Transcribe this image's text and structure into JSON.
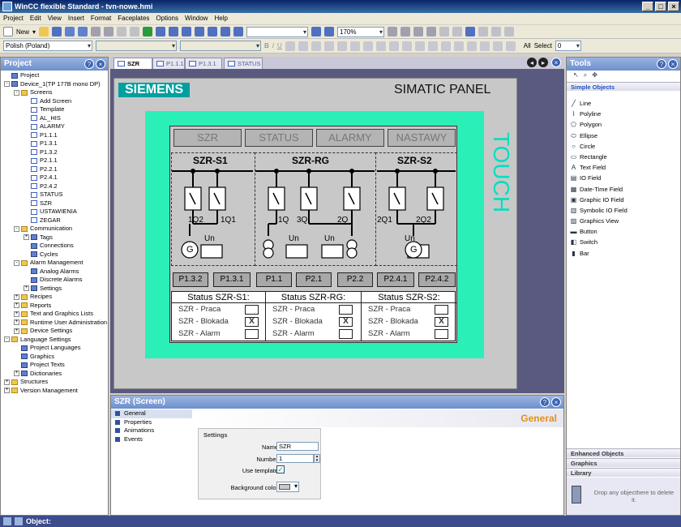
{
  "window": {
    "title": "WinCC flexible Standard - tvn-nowe.hmi"
  },
  "menu": [
    "Project",
    "Edit",
    "View",
    "Insert",
    "Format",
    "Faceplates",
    "Options",
    "Window",
    "Help"
  ],
  "toolbar": {
    "new_label": "New",
    "language": "Polish (Poland)",
    "zoom": "170%",
    "all_label": "All",
    "select_label": "Select",
    "select_value": "0"
  },
  "project_panel": {
    "title": "Project",
    "tree": [
      {
        "label": "Project",
        "level": 0,
        "icon": "gen"
      },
      {
        "label": "Device_1(TP 177B mono DP)",
        "level": 0,
        "icon": "gen",
        "toggle": "-"
      },
      {
        "label": "Screens",
        "level": 1,
        "icon": "fold",
        "toggle": "-"
      },
      {
        "label": "Add Screen",
        "level": 2,
        "icon": "scr"
      },
      {
        "label": "Template",
        "level": 2,
        "icon": "scr"
      },
      {
        "label": "AL_HIS",
        "level": 2,
        "icon": "scr"
      },
      {
        "label": "ALARMY",
        "level": 2,
        "icon": "scr"
      },
      {
        "label": "P1.1.1",
        "level": 2,
        "icon": "scr"
      },
      {
        "label": "P1.3.1",
        "level": 2,
        "icon": "scr"
      },
      {
        "label": "P1.3.2",
        "level": 2,
        "icon": "scr"
      },
      {
        "label": "P2.1.1",
        "level": 2,
        "icon": "scr"
      },
      {
        "label": "P2.2.1",
        "level": 2,
        "icon": "scr"
      },
      {
        "label": "P2.4.1",
        "level": 2,
        "icon": "scr"
      },
      {
        "label": "P2.4.2",
        "level": 2,
        "icon": "scr"
      },
      {
        "label": "STATUS",
        "level": 2,
        "icon": "scr"
      },
      {
        "label": "SZR",
        "level": 2,
        "icon": "scr"
      },
      {
        "label": "USTAWIENIA",
        "level": 2,
        "icon": "scr"
      },
      {
        "label": "ZEGAR",
        "level": 2,
        "icon": "scr"
      },
      {
        "label": "Communication",
        "level": 1,
        "icon": "fold",
        "toggle": "-"
      },
      {
        "label": "Tags",
        "level": 2,
        "icon": "gen",
        "toggle": "+"
      },
      {
        "label": "Connections",
        "level": 2,
        "icon": "gen"
      },
      {
        "label": "Cycles",
        "level": 2,
        "icon": "gen"
      },
      {
        "label": "Alarm Management",
        "level": 1,
        "icon": "fold",
        "toggle": "-"
      },
      {
        "label": "Analog Alarms",
        "level": 2,
        "icon": "gen"
      },
      {
        "label": "Discrete Alarms",
        "level": 2,
        "icon": "gen"
      },
      {
        "label": "Settings",
        "level": 2,
        "icon": "gen",
        "toggle": "+"
      },
      {
        "label": "Recipes",
        "level": 1,
        "icon": "fold",
        "toggle": "+"
      },
      {
        "label": "Reports",
        "level": 1,
        "icon": "fold",
        "toggle": "+"
      },
      {
        "label": "Text and Graphics Lists",
        "level": 1,
        "icon": "fold",
        "toggle": "+"
      },
      {
        "label": "Runtime User Administration",
        "level": 1,
        "icon": "fold",
        "toggle": "+"
      },
      {
        "label": "Device Settings",
        "level": 1,
        "icon": "fold",
        "toggle": "+"
      },
      {
        "label": "Language Settings",
        "level": 0,
        "icon": "fold",
        "toggle": "-"
      },
      {
        "label": "Project Languages",
        "level": 1,
        "icon": "gen"
      },
      {
        "label": "Graphics",
        "level": 1,
        "icon": "gen"
      },
      {
        "label": "Project Texts",
        "level": 1,
        "icon": "gen"
      },
      {
        "label": "Dictionaries",
        "level": 1,
        "icon": "gen",
        "toggle": "+"
      },
      {
        "label": "Structures",
        "level": 0,
        "icon": "fold",
        "toggle": "+"
      },
      {
        "label": "Version Management",
        "level": 0,
        "icon": "fold",
        "toggle": "+"
      }
    ]
  },
  "tabs": [
    {
      "label": "SZR",
      "active": true
    },
    {
      "label": "P1.1.1",
      "active": false
    },
    {
      "label": "P1.3.1",
      "active": false
    },
    {
      "label": "STATUS",
      "active": false
    }
  ],
  "hmi": {
    "logo": "SIEMENS",
    "panel_title": "SIMATIC PANEL",
    "touch": "TOUCH",
    "nav": [
      "SZR",
      "STATUS",
      "ALARMY",
      "NASTAWY"
    ],
    "sections": [
      "SZR-S1",
      "SZR-RG",
      "SZR-S2"
    ],
    "switch_labels": [
      "1Q2",
      "1Q1",
      "1Q",
      "3Q",
      "2Q",
      "2Q1",
      "2Q2"
    ],
    "un_label": "Un",
    "gen_label": "G",
    "page_buttons": [
      "P1.3.2",
      "P1.3.1",
      "P1.1",
      "P2.1",
      "P2.2",
      "P2.4.1",
      "P2.4.2"
    ],
    "status": [
      {
        "title": "Status SZR-S1:",
        "rows": [
          {
            "label": "SZR  - Praca",
            "mark": ""
          },
          {
            "label": "SZR  - Blokada",
            "mark": "X"
          },
          {
            "label": "SZR  - Alarm",
            "mark": ""
          }
        ]
      },
      {
        "title": "Status SZR-RG:",
        "rows": [
          {
            "label": "SZR  - Praca",
            "mark": ""
          },
          {
            "label": "SZR  - Blokada",
            "mark": "X"
          },
          {
            "label": "SZR  - Alarm",
            "mark": ""
          }
        ]
      },
      {
        "title": "Status SZR-S2:",
        "rows": [
          {
            "label": "SZR  - Praca",
            "mark": ""
          },
          {
            "label": "SZR  - Blokada",
            "mark": "X"
          },
          {
            "label": "SZR  - Alarm",
            "mark": ""
          }
        ]
      }
    ]
  },
  "properties": {
    "title": "SZR (Screen)",
    "nav": [
      "General",
      "Properties",
      "Animations",
      "Events"
    ],
    "section": "General",
    "settings_title": "Settings",
    "name_label": "Name",
    "name_value": "SZR",
    "number_label": "Number",
    "number_value": "1",
    "template_label": "Use template",
    "bg_label": "Background color"
  },
  "tools": {
    "title": "Tools",
    "group": "Simple Objects",
    "items": [
      {
        "label": "Line",
        "icon": "line-icon",
        "glyph": "╱"
      },
      {
        "label": "Polyline",
        "icon": "polyline-icon",
        "glyph": "⌇"
      },
      {
        "label": "Polygon",
        "icon": "polygon-icon",
        "glyph": "⬠"
      },
      {
        "label": "Ellipse",
        "icon": "ellipse-icon",
        "glyph": "⬭"
      },
      {
        "label": "Circle",
        "icon": "circle-icon",
        "glyph": "○"
      },
      {
        "label": "Rectangle",
        "icon": "rectangle-icon",
        "glyph": "▭"
      },
      {
        "label": "Text Field",
        "icon": "textfield-icon",
        "glyph": "A"
      },
      {
        "label": "IO Field",
        "icon": "iofield-icon",
        "glyph": "▤"
      },
      {
        "label": "Date-Time Field",
        "icon": "datetime-icon",
        "glyph": "▦"
      },
      {
        "label": "Graphic IO Field",
        "icon": "graphic-io-icon",
        "glyph": "▣"
      },
      {
        "label": "Symbolic IO Field",
        "icon": "symbolic-io-icon",
        "glyph": "▥"
      },
      {
        "label": "Graphics View",
        "icon": "graphics-view-icon",
        "glyph": "▨"
      },
      {
        "label": "Button",
        "icon": "button-icon",
        "glyph": "▬"
      },
      {
        "label": "Switch",
        "icon": "switch-icon",
        "glyph": "◧"
      },
      {
        "label": "Bar",
        "icon": "bar-icon",
        "glyph": "▮"
      }
    ],
    "groups_bottom": [
      "Enhanced Objects",
      "Graphics",
      "Library"
    ],
    "drop_text": "Drop any objecthere to delete it."
  },
  "statusbar": {
    "label": "Object:"
  }
}
